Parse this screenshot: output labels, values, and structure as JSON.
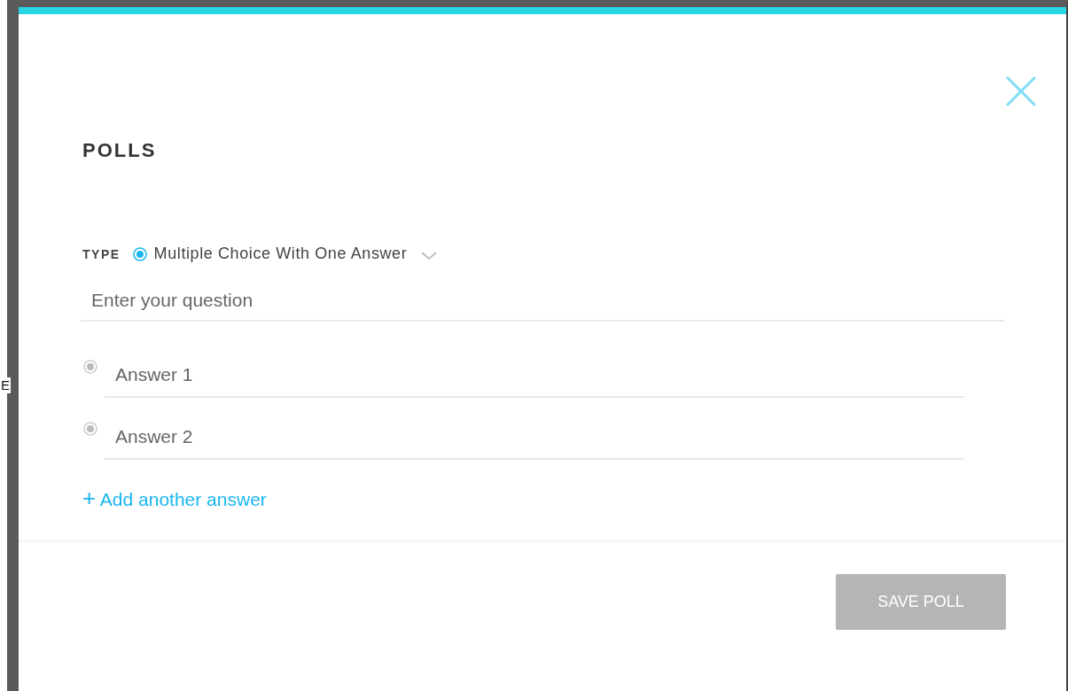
{
  "backdrop_text": "E",
  "modal": {
    "title": "POLLS",
    "type": {
      "label": "TYPE",
      "value": "Multiple Choice With One Answer",
      "selected": true
    },
    "question": {
      "placeholder": "Enter your question"
    },
    "answers": [
      {
        "placeholder": "Answer 1",
        "selected": false
      },
      {
        "placeholder": "Answer 2",
        "selected": false
      }
    ],
    "add_answer": {
      "icon": "+",
      "label": "Add another answer"
    },
    "save_button": {
      "label": "SAVE POLL",
      "disabled": true
    }
  }
}
